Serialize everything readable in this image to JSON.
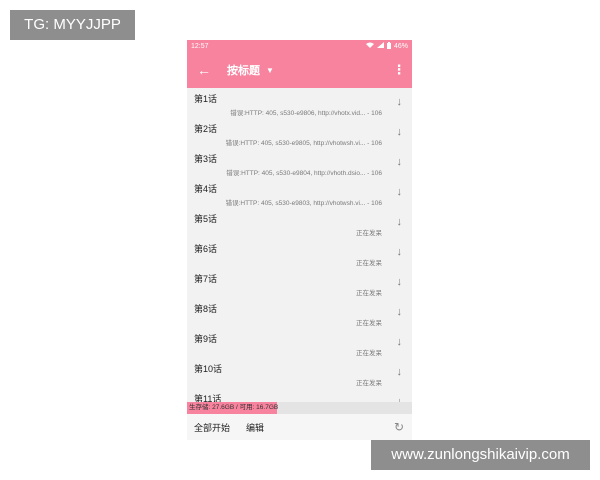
{
  "watermark_top": "TG: MYYJJPP",
  "watermark_bottom": "www.zunlongshikaivip.com",
  "status_bar": {
    "time": "12:57",
    "battery": "46%"
  },
  "toolbar": {
    "title": "按标题"
  },
  "items": [
    {
      "name": "第1话",
      "status": "错误:HTTP: 405, s530-e9806, http://vhotx.vid... - 106"
    },
    {
      "name": "第2话",
      "status": "错误:HTTP: 405, s530-e9805, http://vhotwsh.vi... - 106"
    },
    {
      "name": "第3话",
      "status": "错误:HTTP: 405, s530-e9804, http://vhoth.dsio... - 106"
    },
    {
      "name": "第4话",
      "status": "错误:HTTP: 405, s530-e9803, http://vhotwsh.vi... - 106"
    },
    {
      "name": "第5话",
      "status": "正在发呆"
    },
    {
      "name": "第6话",
      "status": "正在发呆"
    },
    {
      "name": "第7话",
      "status": "正在发呆"
    },
    {
      "name": "第8话",
      "status": "正在发呆"
    },
    {
      "name": "第9话",
      "status": "正在发呆"
    },
    {
      "name": "第10话",
      "status": "正在发呆"
    },
    {
      "name": "第11话",
      "status": ""
    }
  ],
  "storage": {
    "text": "生存储: 27.6GB  / 可用: 16.7GB",
    "used_fraction": 0.4
  },
  "bottom_bar": {
    "start_all": "全部开始",
    "edit": "编辑"
  },
  "colors": {
    "accent": "#f7839e",
    "background": "#f2f2f2"
  }
}
